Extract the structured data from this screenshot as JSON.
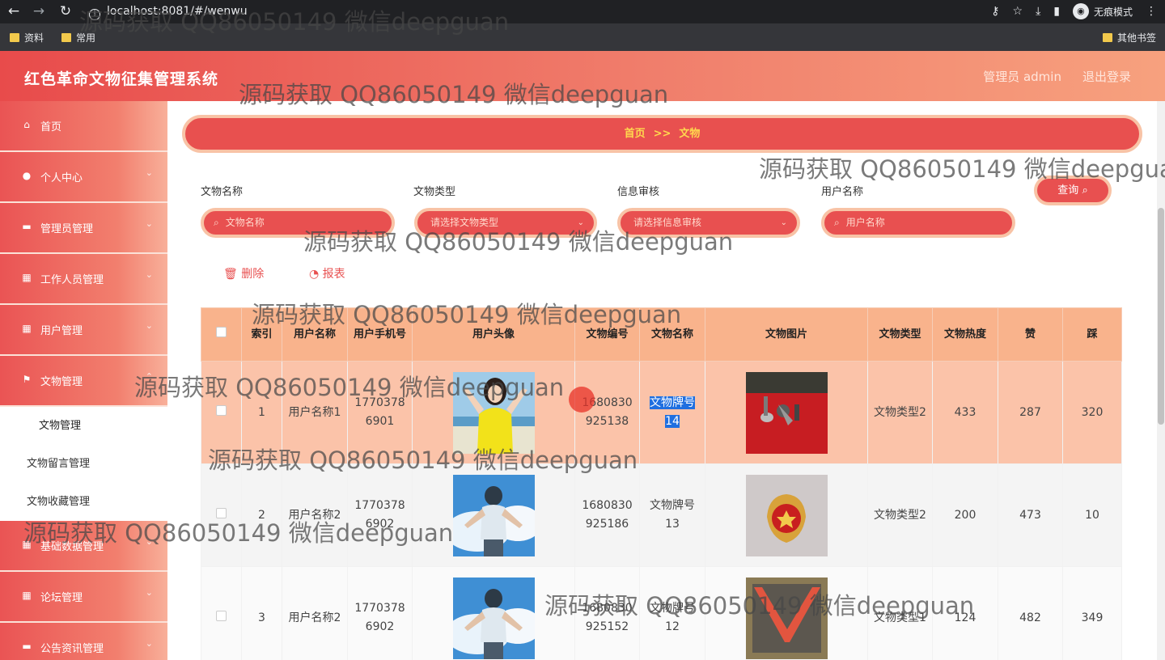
{
  "browser": {
    "url": "localhost:8081/#/wenwu",
    "incognito_label": "无痕模式",
    "bookmarks": [
      "资料",
      "常用"
    ],
    "other_bookmarks": "其他书签"
  },
  "header": {
    "title": "红色革命文物征集管理系统",
    "user": "管理员 admin",
    "logout": "退出登录"
  },
  "sidebar": {
    "items": [
      {
        "label": "首页",
        "icon": "home-icon"
      },
      {
        "label": "个人中心",
        "icon": "user-icon"
      },
      {
        "label": "管理员管理",
        "icon": "briefcase-icon"
      },
      {
        "label": "工作人员管理",
        "icon": "grid-icon"
      },
      {
        "label": "用户管理",
        "icon": "grid-icon"
      },
      {
        "label": "文物管理",
        "icon": "flag-icon"
      }
    ],
    "sub_items": [
      "文物管理",
      "文物留言管理",
      "文物收藏管理"
    ],
    "lower_items": [
      {
        "label": "基础数据管理",
        "icon": "grid-icon"
      },
      {
        "label": "论坛管理",
        "icon": "grid-icon"
      },
      {
        "label": "公告资讯管理",
        "icon": "monitor-icon"
      }
    ]
  },
  "breadcrumb": {
    "home": "首页",
    "sep": ">>",
    "current": "文物"
  },
  "filters": {
    "name_label": "文物名称",
    "name_placeholder": "文物名称",
    "type_label": "文物类型",
    "type_placeholder": "请选择文物类型",
    "audit_label": "信息审核",
    "audit_placeholder": "请选择信息审核",
    "user_label": "用户名称",
    "user_placeholder": "用户名称",
    "query_button": "查询"
  },
  "actions": {
    "delete": "删除",
    "report": "报表"
  },
  "table": {
    "headers": [
      "索引",
      "用户名称",
      "用户手机号",
      "用户头像",
      "文物编号",
      "文物名称",
      "文物图片",
      "文物类型",
      "文物热度",
      "赞",
      "踩"
    ],
    "rows": [
      {
        "index": "1",
        "user": "用户名称1",
        "phone": "17703786901",
        "code": "1680830925138",
        "name": "文物牌号14",
        "type": "文物类型2",
        "heat": "433",
        "likes": "287",
        "dislikes": "320"
      },
      {
        "index": "2",
        "user": "用户名称2",
        "phone": "17703786902",
        "code": "1680830925186",
        "name": "文物牌号13",
        "type": "文物类型2",
        "heat": "200",
        "likes": "473",
        "dislikes": "10"
      },
      {
        "index": "3",
        "user": "用户名称2",
        "phone": "17703786902",
        "code": "1680830925152",
        "name": "文物牌号12",
        "type": "文物类型1",
        "heat": "124",
        "likes": "482",
        "dislikes": "349"
      }
    ]
  },
  "watermark": "源码获取 QQ86050149 微信deepguan"
}
